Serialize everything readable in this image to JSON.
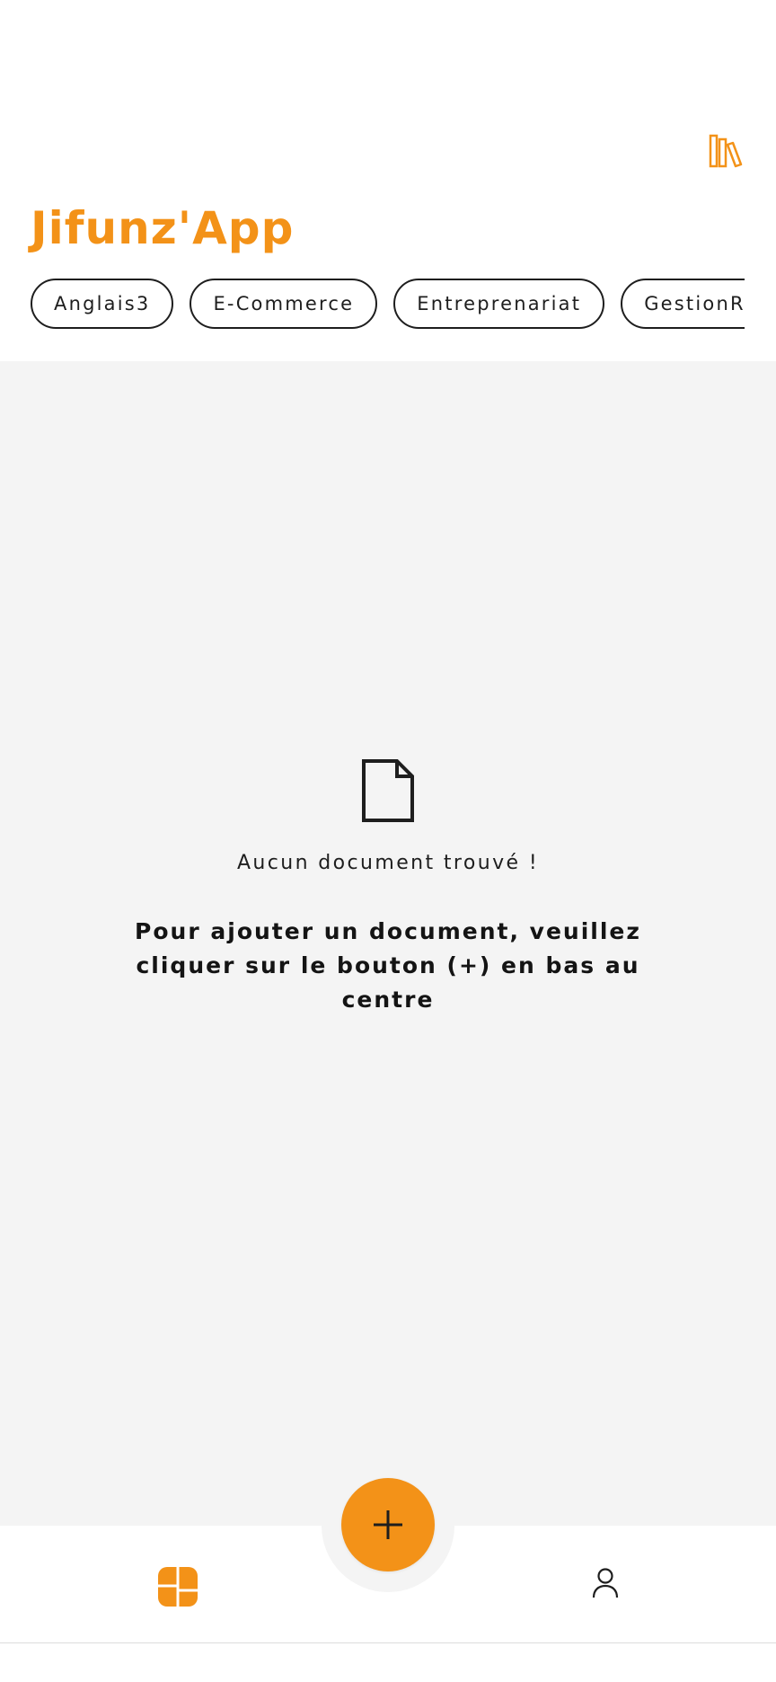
{
  "colors": {
    "accent": "#F39218",
    "text": "#1E1E1E",
    "background_main": "#F4F4F4",
    "background_header": "#FFFFFF"
  },
  "header": {
    "title": "Jifunz'App",
    "library_icon": "library-books-icon"
  },
  "categories": [
    {
      "label": "Anglais3"
    },
    {
      "label": "E-Commerce"
    },
    {
      "label": "Entreprenariat"
    },
    {
      "label": "GestionR"
    }
  ],
  "empty_state": {
    "icon": "document-icon",
    "title": "Aucun document trouvé !",
    "hint": "Pour ajouter un document, veuillez cliquer sur le bouton (+) en bas au centre"
  },
  "bottom_nav": {
    "fab_icon": "plus-icon",
    "dashboard_icon": "dashboard-icon",
    "profile_icon": "user-icon"
  }
}
